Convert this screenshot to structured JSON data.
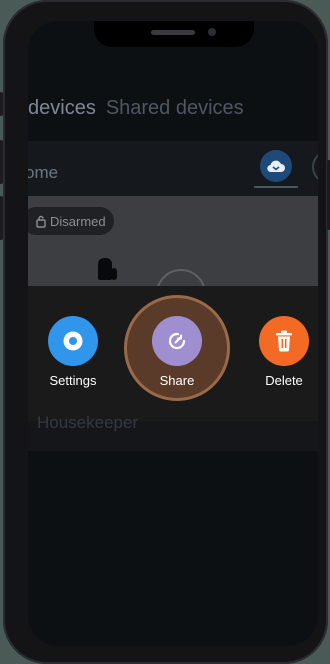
{
  "tabs": {
    "active": "devices",
    "inactive": "Shared devices"
  },
  "device": {
    "home_title": "ome",
    "status_badge": "Disarmed",
    "lower_label": "Housekeeper"
  },
  "actions": {
    "settings_label": "Settings",
    "share_label": "Share",
    "delete_label": "Delete"
  },
  "icons": {
    "cloud": "cloud-icon",
    "lock": "lock-icon",
    "settings": "settings-icon",
    "share": "share-icon",
    "delete": "trash-icon"
  },
  "colors": {
    "settings": "#2f96ec",
    "share": "#9f8fd0",
    "delete": "#f26a23",
    "share_highlight": "#9a6a48"
  }
}
